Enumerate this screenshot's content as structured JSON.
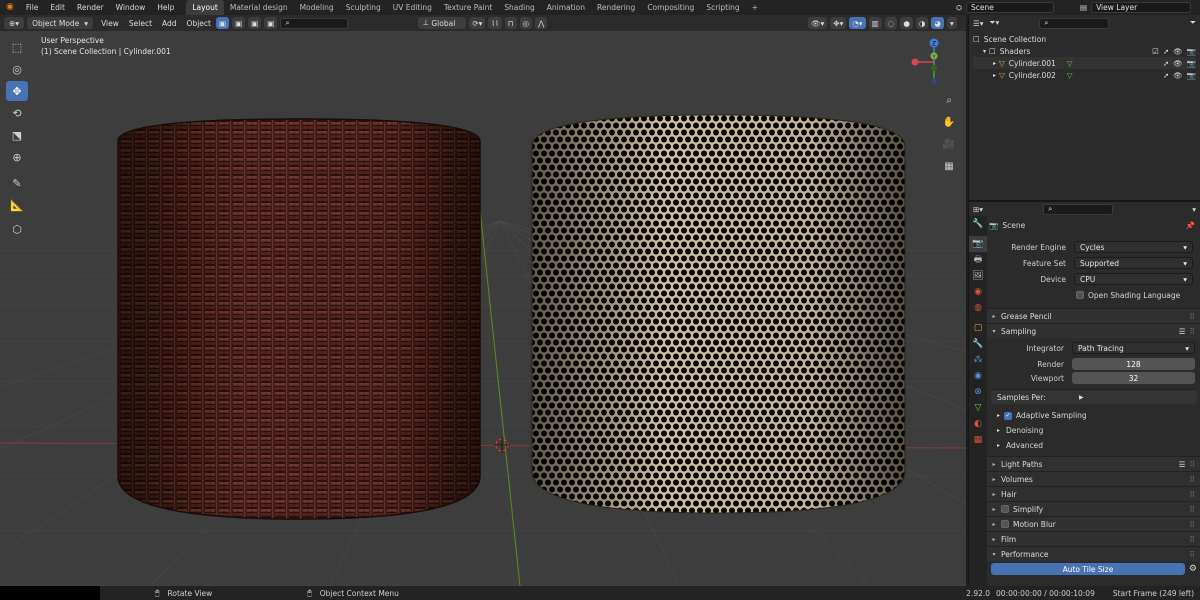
{
  "menu": [
    "File",
    "Edit",
    "Render",
    "Window",
    "Help"
  ],
  "workspaces": [
    "Layout",
    "Material design",
    "Modeling",
    "Sculpting",
    "UV Editing",
    "Texture Paint",
    "Shading",
    "Animation",
    "Rendering",
    "Compositing",
    "Scripting"
  ],
  "workspace_add": "+",
  "scene_name": "Scene",
  "view_layer": "View Layer",
  "viewport_header": {
    "mode": "Object Mode",
    "view": "View",
    "select": "Select",
    "add": "Add",
    "object": "Object",
    "orientation": "Global"
  },
  "viewport_info": {
    "line1": "User Perspective",
    "line2": "(1) Scene Collection | Cylinder.001"
  },
  "gizmo": {
    "x": "X",
    "y": "Y",
    "z": "Z"
  },
  "outliner": {
    "root": "Scene Collection",
    "collection": "Shaders",
    "items": [
      "Cylinder.001",
      "Cylinder.002"
    ]
  },
  "properties": {
    "scene_label": "Scene",
    "render_engine_label": "Render Engine",
    "render_engine": "Cycles",
    "feature_set_label": "Feature Set",
    "feature_set": "Supported",
    "device_label": "Device",
    "device": "CPU",
    "osl_label": "Open Shading Language",
    "grease_pencil": "Grease Pencil",
    "sampling": "Sampling",
    "integrator_label": "Integrator",
    "integrator": "Path Tracing",
    "render_label": "Render",
    "render_val": "128",
    "viewport_label": "Viewport",
    "viewport_val": "32",
    "samples_per_label": "Samples Per:",
    "adaptive": "Adaptive Sampling",
    "denoising": "Denoising",
    "advanced": "Advanced",
    "light_paths": "Light Paths",
    "volumes": "Volumes",
    "hair": "Hair",
    "simplify": "Simplify",
    "motion_blur": "Motion Blur",
    "film": "Film",
    "performance": "Performance",
    "auto_tile": "Auto Tile Size"
  },
  "status": {
    "rotate": "Rotate View",
    "context": "Object Context Menu",
    "version": "2.92.0",
    "time": "00:00:00:00 / 00:00:10:09",
    "frame": "Start Frame (249 left)"
  }
}
